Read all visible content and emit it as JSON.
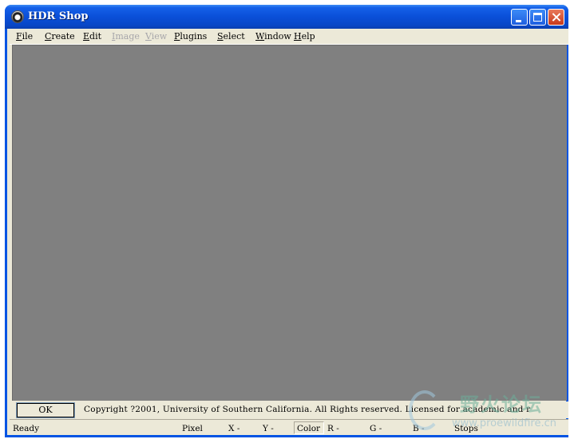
{
  "window": {
    "title": "HDR Shop",
    "minimize": "minimize",
    "maximize": "maximize",
    "close": "close"
  },
  "menu": {
    "file": {
      "acc": "F",
      "rest": "ile"
    },
    "create": {
      "acc": "C",
      "rest": "reate"
    },
    "edit": {
      "acc": "E",
      "rest": "dit"
    },
    "image": {
      "acc": "I",
      "rest": "mage"
    },
    "view": {
      "acc": "V",
      "rest": "iew"
    },
    "plugins": {
      "acc": "P",
      "rest": "lugins"
    },
    "select": {
      "acc": "S",
      "rest": "elect"
    },
    "window": {
      "acc": "W",
      "rest": "indow"
    },
    "help": {
      "acc": "H",
      "rest": "elp"
    }
  },
  "infobar": {
    "ok_label": "OK",
    "copyright": "Copyright ?2001, University of Southern California. All Rights reserved. Licensed for academic and r"
  },
  "statusbar": {
    "ready": "Ready",
    "pixel": "Pixel",
    "x": "X -",
    "y": "Y -",
    "color": "Color",
    "r": "R -",
    "g": "G -",
    "b": "B -",
    "stops": "Stops"
  },
  "watermark": {
    "text": "野火论坛",
    "url": "www.proewildfire.cn"
  },
  "colors": {
    "titlebar": "#0A4FD8",
    "workspace": "#808080",
    "chrome": "#ECE9D8",
    "disabled_text": "#A7A6AA"
  }
}
